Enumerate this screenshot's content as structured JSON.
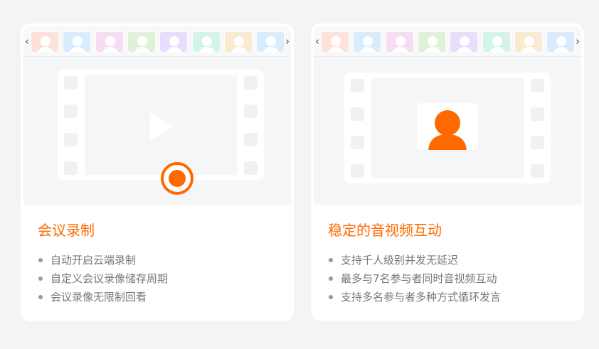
{
  "colors": {
    "accent": "#ff6a00",
    "page_background": "#f4f4f4",
    "thumb_palette": [
      "#fde2dc",
      "#d9ecfd",
      "#f8dcf4",
      "#dff2d8",
      "#e6defc",
      "#d4f4ea",
      "#fbead2",
      "#d9ecfd"
    ]
  },
  "nav": {
    "prev_glyph": "‹",
    "next_glyph": "›"
  },
  "cards": [
    {
      "title": "会议录制",
      "icons": [
        "play-icon",
        "record-icon"
      ],
      "features": [
        "自动开启云端录制",
        "自定义会议录像储存周期",
        "会议录像无限制回看"
      ]
    },
    {
      "title": "稳定的音视频互动",
      "icons": [
        "person-icon"
      ],
      "features": [
        "支持千人级别并发无延迟",
        "最多与7名参与者同时音视频互动",
        "支持多名参与者多种方式循环发言"
      ]
    }
  ]
}
